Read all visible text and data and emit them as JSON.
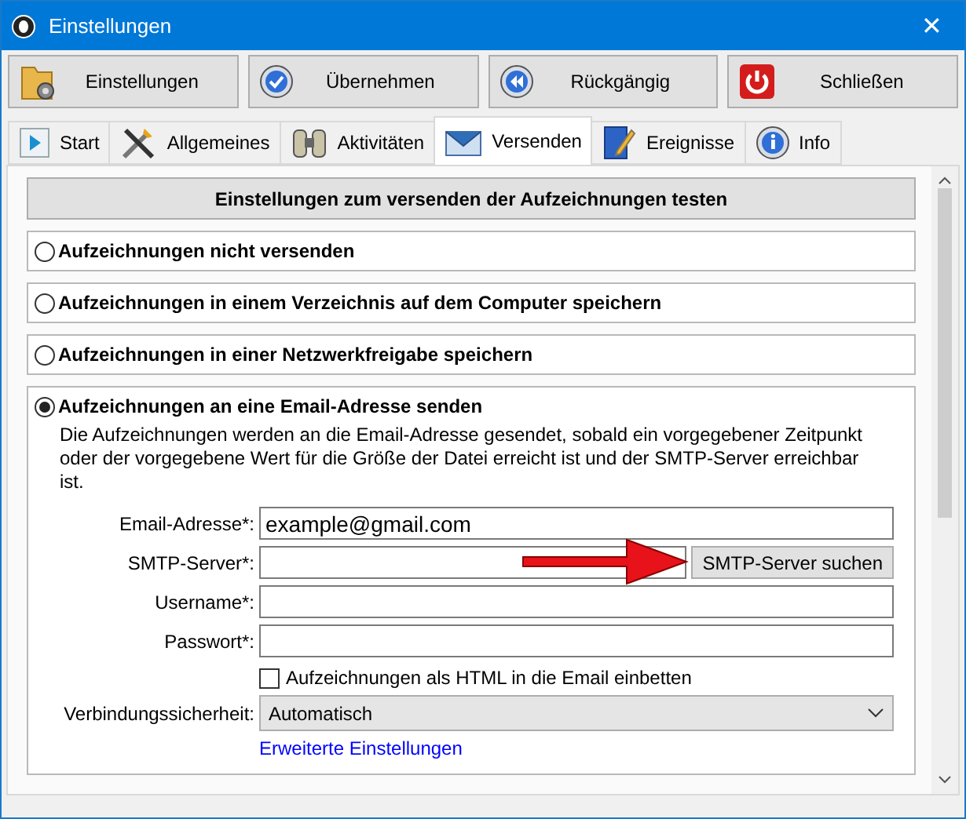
{
  "window": {
    "title": "Einstellungen",
    "close": "✕"
  },
  "toolbar": [
    {
      "kind": "settings",
      "label": "Einstellungen"
    },
    {
      "kind": "apply",
      "label": "Übernehmen"
    },
    {
      "kind": "undo",
      "label": "Rückgängig"
    },
    {
      "kind": "power",
      "label": "Schließen"
    }
  ],
  "tabs": [
    {
      "kind": "start",
      "label": "Start",
      "selected": false
    },
    {
      "kind": "tools",
      "label": "Allgemeines",
      "selected": false
    },
    {
      "kind": "binoculars",
      "label": "Aktivitäten",
      "selected": false
    },
    {
      "kind": "mail",
      "label": "Versenden",
      "selected": true
    },
    {
      "kind": "notes",
      "label": "Ereignisse",
      "selected": false
    },
    {
      "kind": "info",
      "label": "Info",
      "selected": false
    }
  ],
  "test_button": "Einstellungen zum versenden der Aufzeichnungen testen",
  "options": [
    {
      "label": "Aufzeichnungen nicht versenden",
      "selected": false
    },
    {
      "label": "Aufzeichnungen in einem Verzeichnis auf dem Computer speichern",
      "selected": false
    },
    {
      "label": "Aufzeichnungen in einer Netzwerkfreigabe speichern",
      "selected": false
    },
    {
      "label": "Aufzeichnungen an eine Email-Adresse senden",
      "selected": true
    }
  ],
  "email_section": {
    "description": "Die Aufzeichnungen werden an die Email-Adresse gesendet, sobald ein vorgegebener Zeitpunkt oder der vorgegebene Wert für die Größe der Datei erreicht ist und der SMTP-Server erreichbar ist.",
    "fields": [
      {
        "kind": "text",
        "label": "Email-Adresse*:",
        "value": "example@gmail.com"
      },
      {
        "kind": "search",
        "label": "SMTP-Server*:",
        "button": "SMTP-Server suchen"
      },
      {
        "kind": "text",
        "label": "Username*:"
      },
      {
        "kind": "password",
        "label": "Passwort*:"
      }
    ],
    "html_checkbox": {
      "label": "Aufzeichnungen als HTML in die Email einbetten",
      "checked": false
    },
    "security": {
      "label": "Verbindungssicherheit:",
      "value": "Automatisch"
    },
    "advanced_link": "Erweiterte Einstellungen"
  }
}
